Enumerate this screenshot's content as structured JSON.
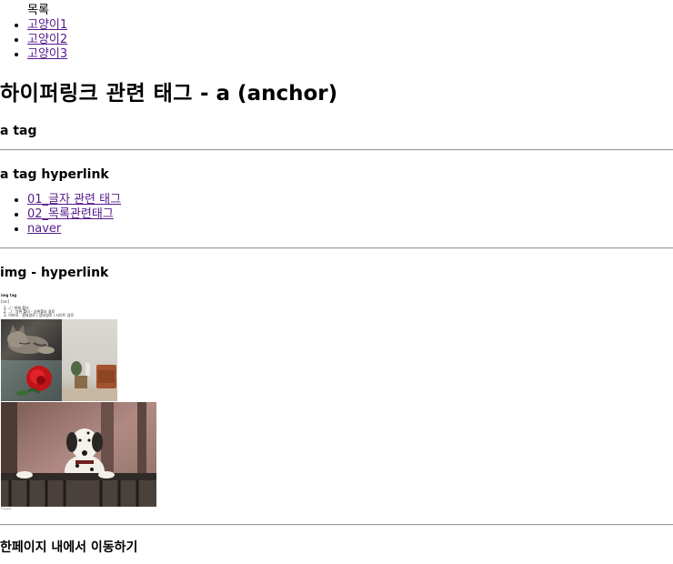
{
  "toc": {
    "title": "목록",
    "items": [
      "고양이1",
      "고양이2",
      "고양이3"
    ]
  },
  "page_title": {
    "korean": "하이퍼링크 관련 태그",
    "rest": " - a (anchor)"
  },
  "sections": {
    "a_tag": "a tag",
    "a_tag_hyperlink": "a tag hyperlink",
    "img_hyperlink": "img - hyperlink",
    "in_page": "한페이지 내에서 이동하기"
  },
  "hyperlinks": [
    "01_글자 관련 태그",
    "02_목록관련태그",
    "naver"
  ],
  "thumbnail": {
    "heading": "img tag",
    "subheading": "[src]",
    "lines": [
      "1. ./ : 현재 폴더",
      "2. ../ : 상위 폴더 - 상위폴더 경로",
      "3. 이미지 - 절대경로 / 상대경로 / 사이트 경로"
    ]
  },
  "footer_small": "dog.jpg"
}
